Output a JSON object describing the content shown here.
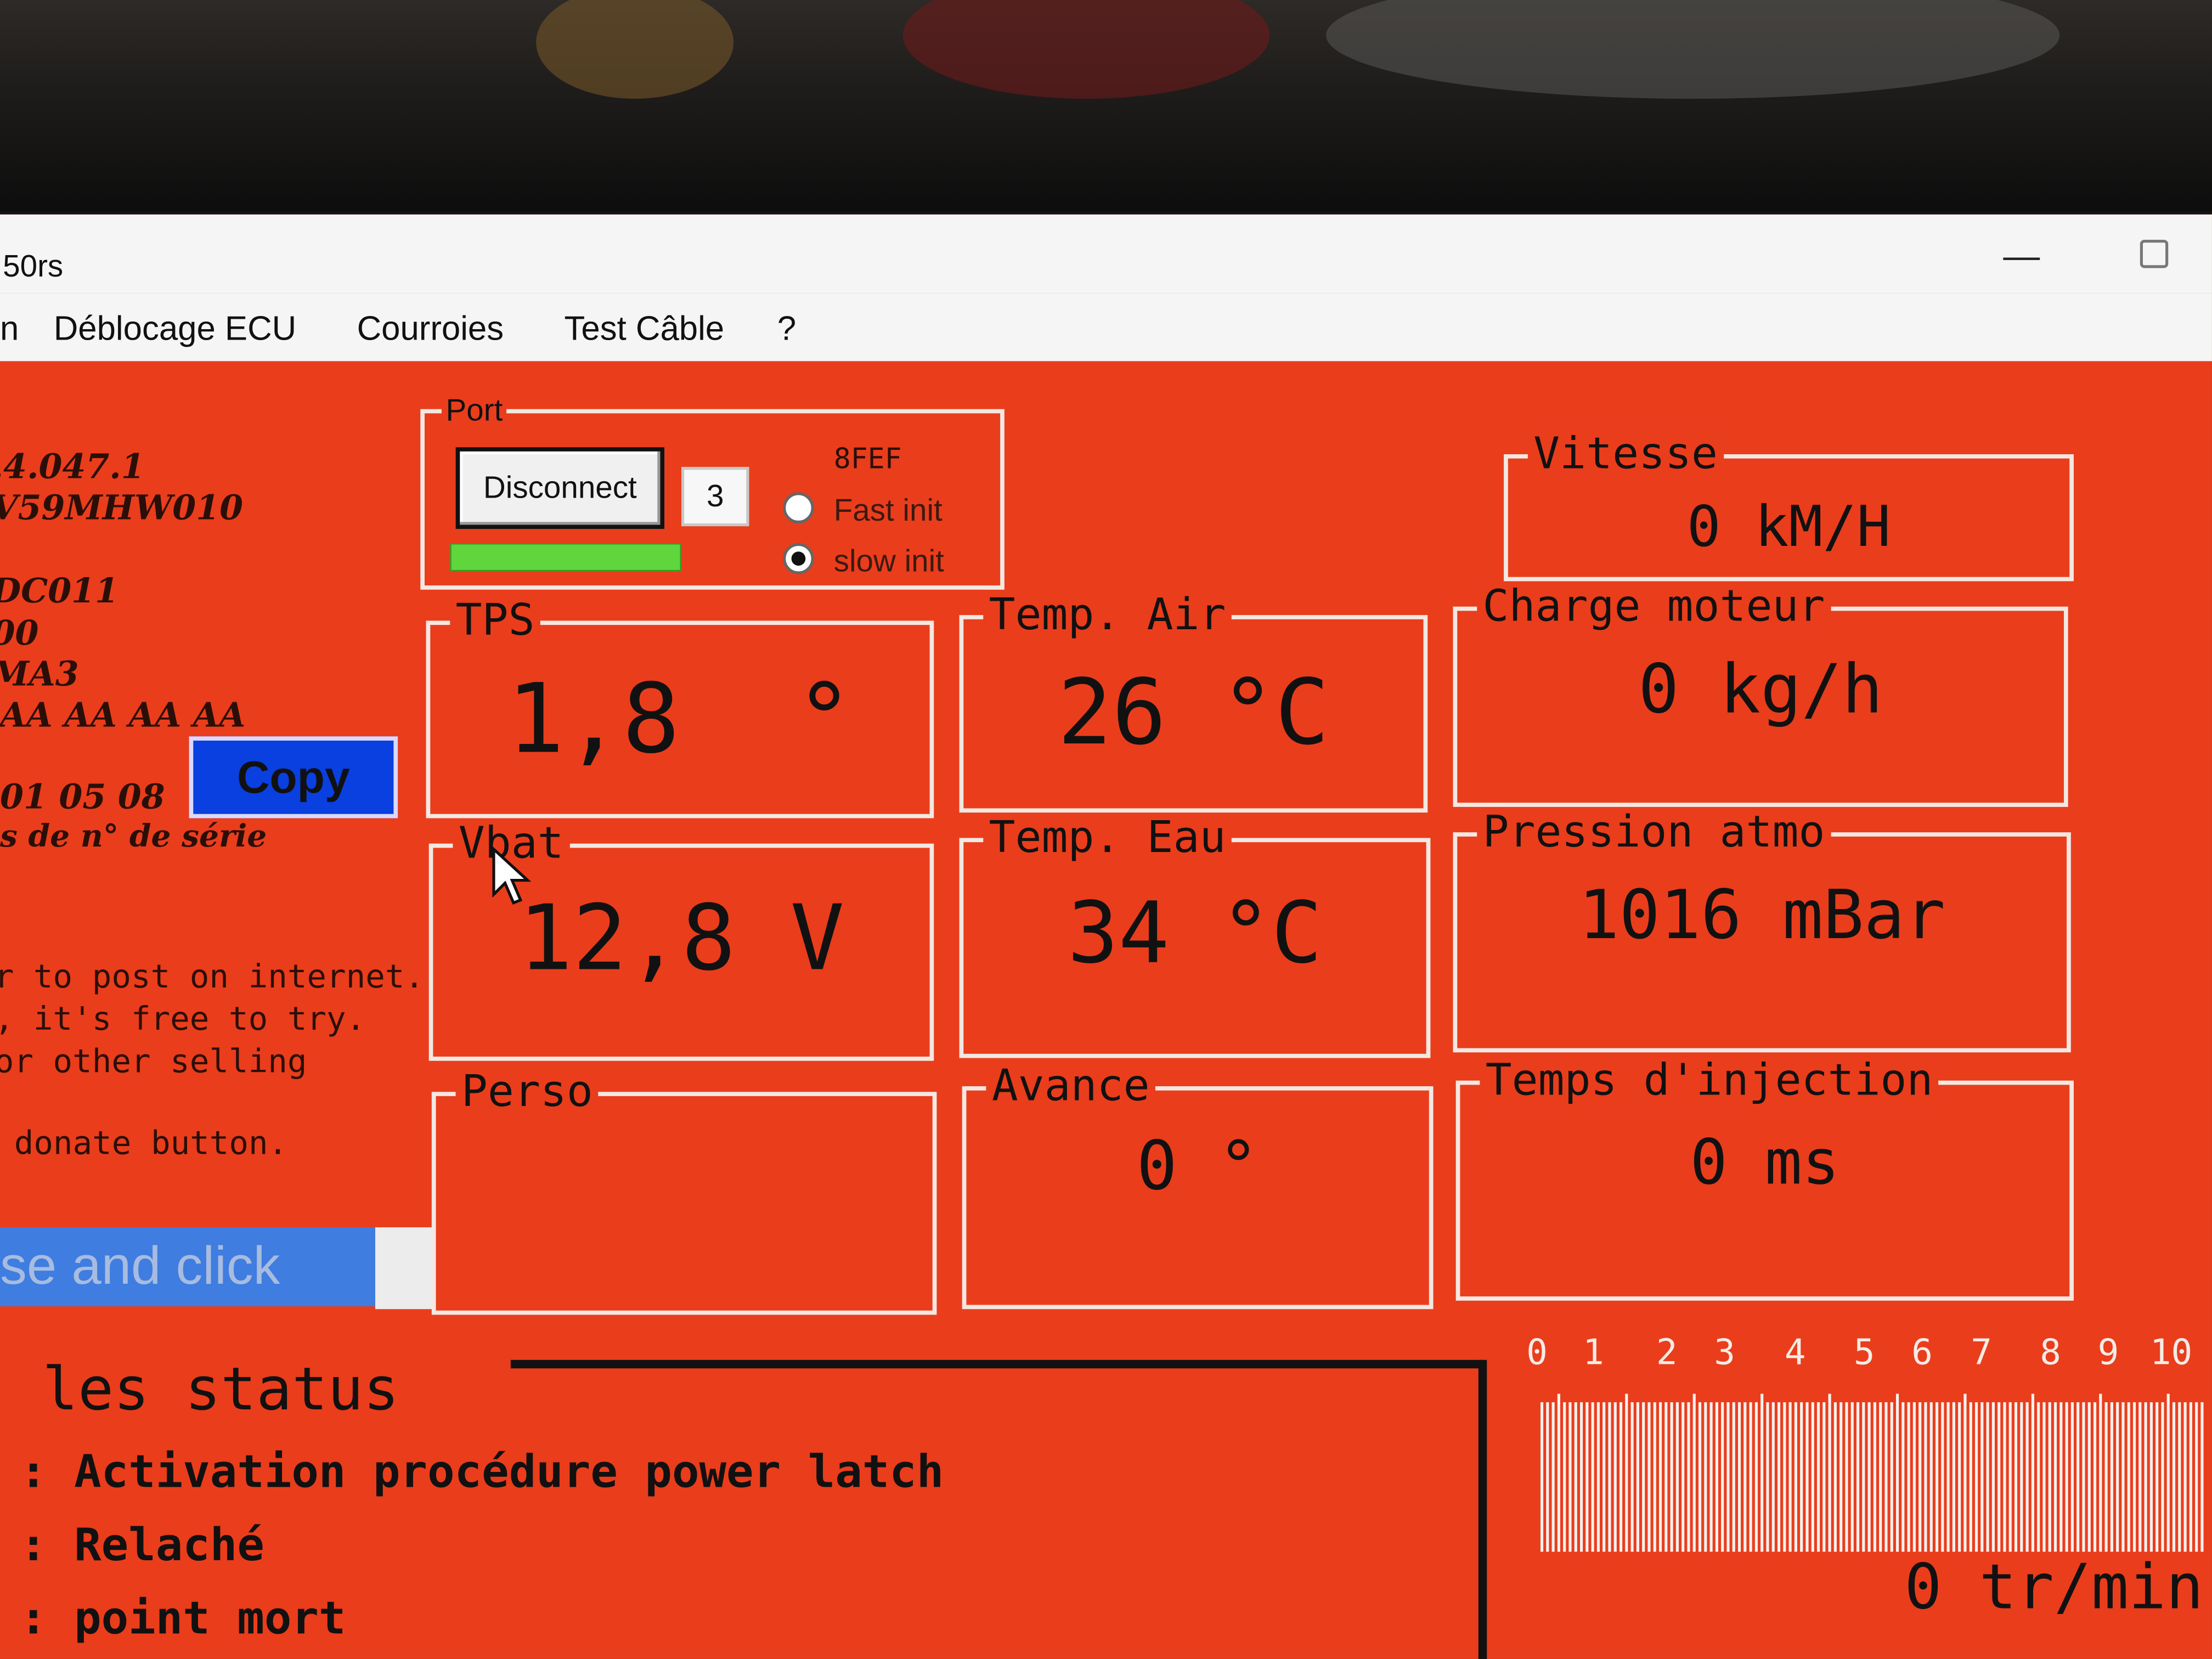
{
  "window": {
    "title": "50rs"
  },
  "menu": {
    "items": [
      "n",
      "Déblocage ECU",
      "Courroies",
      "Test Câble",
      "?"
    ]
  },
  "left_info": {
    "lines": [
      ".4.047.1",
      "V59MHW010",
      "DC011",
      "00",
      "MA3",
      "AA AA AA AA"
    ],
    "serial_date": "01 05 08",
    "serial_caption": "s de n° de série",
    "copy_label": "Copy",
    "notice_lines": [
      "r to post on internet.",
      ", it's free to try.",
      "or other selling",
      "donate button."
    ],
    "donate_label": "se and click"
  },
  "port": {
    "legend": "Port",
    "disconnect_label": "Disconnect",
    "port_number": "3",
    "code": "8FEF",
    "fast_init_label": "Fast init",
    "slow_init_label": "slow init",
    "selected_init": "slow init",
    "progress_fraction": 1.0
  },
  "gauges": {
    "vitesse": {
      "label": "Vitesse",
      "value": "0 kM/H"
    },
    "tps": {
      "label": "TPS",
      "value": "1,8  °"
    },
    "temp_air": {
      "label": "Temp. Air",
      "value": "26 °C"
    },
    "charge": {
      "label": "Charge moteur",
      "value": "0 kg/h"
    },
    "vbat": {
      "label": "Vbat",
      "value": "12,8 V"
    },
    "temp_eau": {
      "label": "Temp. Eau",
      "value": "34 °C"
    },
    "pression": {
      "label": "Pression atmo",
      "value": "1016 mBar"
    },
    "perso": {
      "label": "Perso",
      "value": ""
    },
    "avance": {
      "label": "Avance",
      "value": "0 °"
    },
    "injection": {
      "label": "Temps d'injection",
      "value": "0 ms"
    }
  },
  "status": {
    "title": "les status",
    "rows": [
      ": Activation procédure power latch",
      ": Relaché",
      ": point mort"
    ]
  },
  "rpm": {
    "scale": [
      "0",
      "1",
      "2",
      "3",
      "4",
      "5",
      "6",
      "7",
      "8",
      "9",
      "10"
    ],
    "value": "0 tr/min"
  },
  "colors": {
    "background": "#ea3d1c",
    "copy_button": "#0a3fe0",
    "donate_button": "#3f7de0",
    "progress": "#5fd63c"
  }
}
